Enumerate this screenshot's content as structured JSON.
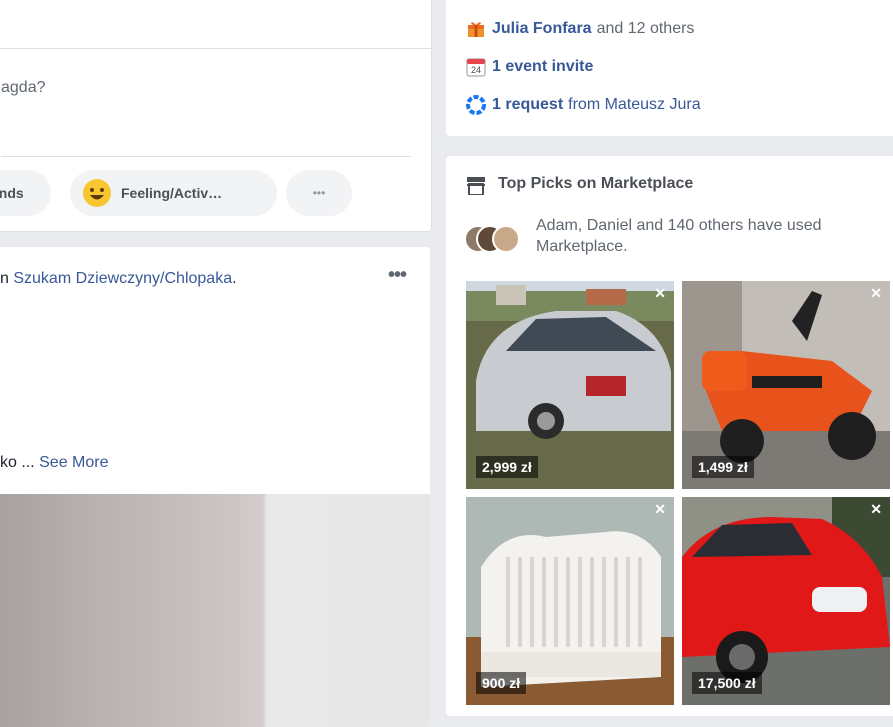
{
  "composer": {
    "prompt": "agda?",
    "pills": [
      {
        "label": "ends"
      },
      {
        "label": "Feeling/Activ…"
      },
      {
        "label": "•••"
      }
    ]
  },
  "post": {
    "header_prefix": "n ",
    "group_link": "Szukam Dziewczyny/Chlopaka",
    "header_suffix": ".",
    "body_prefix": "ko ... ",
    "see_more": "See More",
    "menu_label": "•••"
  },
  "notifications": {
    "birthday": {
      "name": "Julia Fonfara",
      "rest": "and 12 others",
      "icon": "gift-icon"
    },
    "events": {
      "label": "1 event invite",
      "icon": "calendar-icon",
      "day": "24"
    },
    "requests": {
      "label": "1 request",
      "rest": "from Mateusz Jura",
      "icon": "friend-request-icon"
    }
  },
  "marketplace": {
    "title": "Top Picks on Marketplace",
    "icon": "shop-icon",
    "users_text": "Adam, Daniel and 140 others have used Marketplace.",
    "items": [
      {
        "price": "2,999 zł",
        "subject": "silver sedan car"
      },
      {
        "price": "1,499 zł",
        "subject": "orange scooter"
      },
      {
        "price": "900 zł",
        "subject": "white baby crib"
      },
      {
        "price": "17,500 zł",
        "subject": "red hatchback car"
      }
    ]
  },
  "colors": {
    "background": "#e9ebee",
    "link": "#385898",
    "card": "#ffffff"
  }
}
